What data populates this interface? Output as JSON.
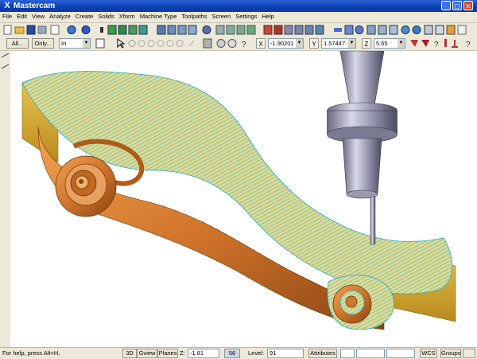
{
  "window": {
    "title": "Mastercam"
  },
  "menu": [
    "File",
    "Edit",
    "View",
    "Analyze",
    "Create",
    "Solids",
    "Xform",
    "Machine Type",
    "Toolpaths",
    "Screen",
    "Settings",
    "Help"
  ],
  "toolbar2": {
    "all_label": "All...",
    "only_label": "Only...",
    "units_value": "In",
    "x_label": "X",
    "x_value": "-1.90201",
    "y_label": "Y",
    "y_value": "1.57447",
    "z_label": "Z",
    "z_value": "5.65"
  },
  "status": {
    "help_text": "For help, press Alt+H.",
    "view_3d": "3D",
    "gview": "Gview",
    "planes": "Planes",
    "z_label": "Z:",
    "z_value": "-1.81",
    "color_value": "56",
    "level_label": "Level:",
    "level_value": "91",
    "attributes": "Attributes",
    "wcs": "WCS",
    "groups": "Groups"
  },
  "colors": {
    "titlebar": "#0a3fb0",
    "part_orange": "#d47a2a",
    "stock_yellow": "#d9b84a",
    "toolpath_cyan": "#40c8d8"
  }
}
